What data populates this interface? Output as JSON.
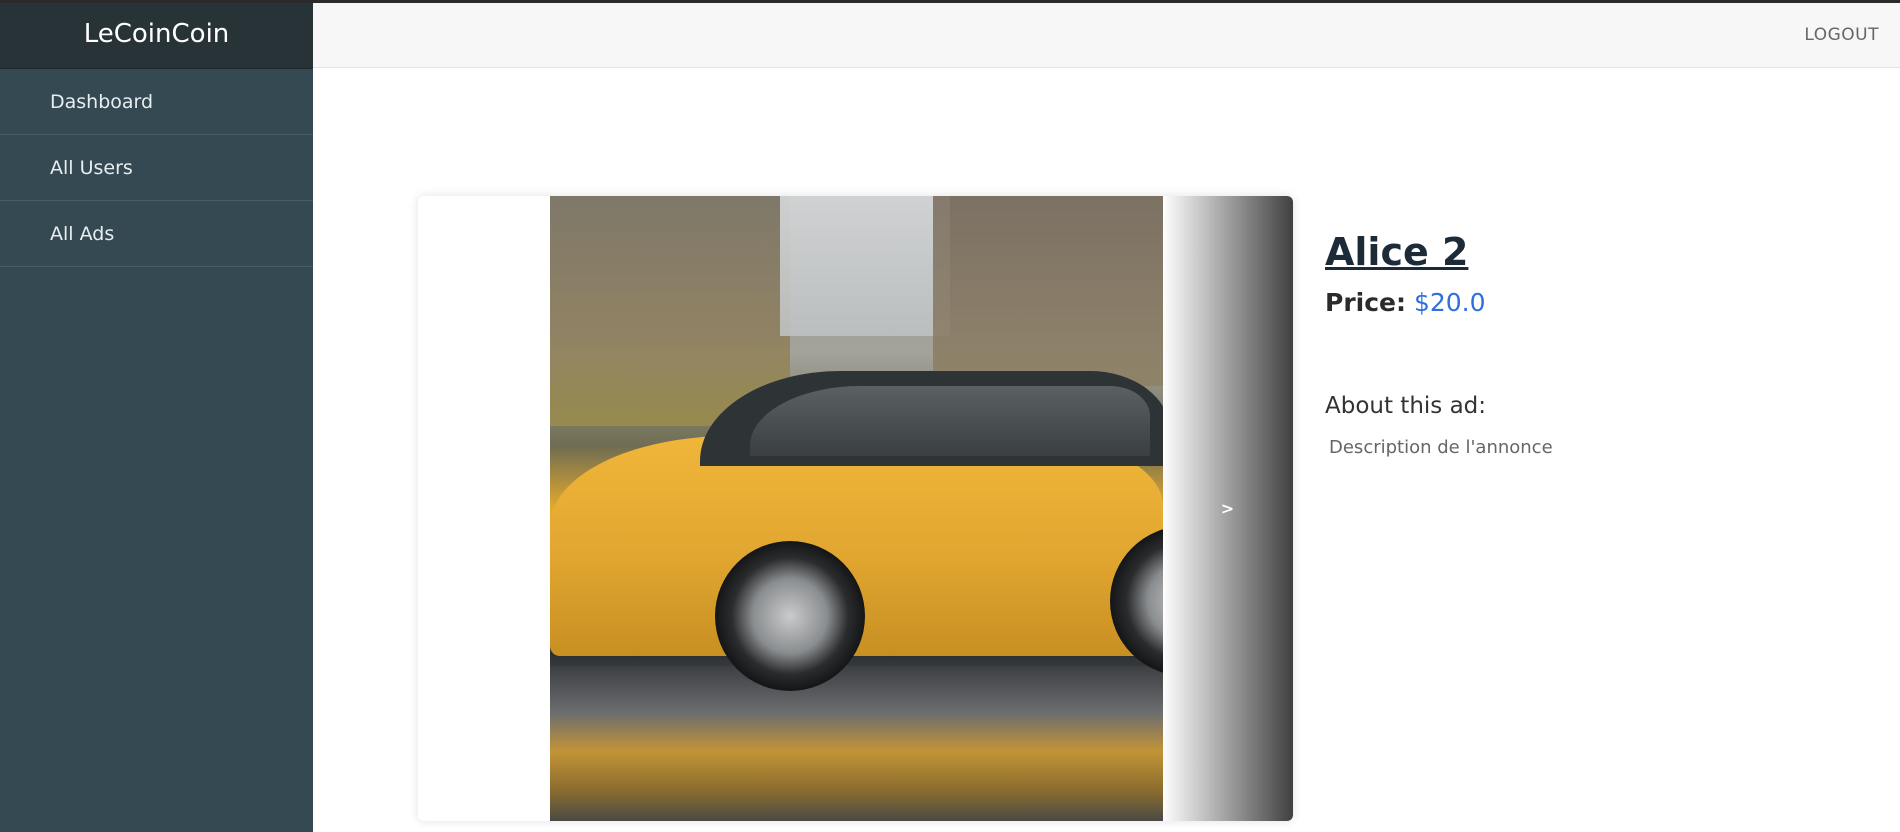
{
  "brand": "LeCoinCoin",
  "sidebar": {
    "items": [
      {
        "label": "Dashboard"
      },
      {
        "label": "All Users"
      },
      {
        "label": "All Ads"
      }
    ]
  },
  "header": {
    "logout_label": "LOGOUT"
  },
  "carousel": {
    "next_label": ">"
  },
  "ad": {
    "title": "Alice 2",
    "price_label": "Price:",
    "price_value": "$20.0",
    "about_label": "About this ad:",
    "description": "Description de l'annonce"
  },
  "colors": {
    "sidebar": "#354952",
    "brand_bar": "#283338",
    "price_accent": "#2f6fdc"
  }
}
